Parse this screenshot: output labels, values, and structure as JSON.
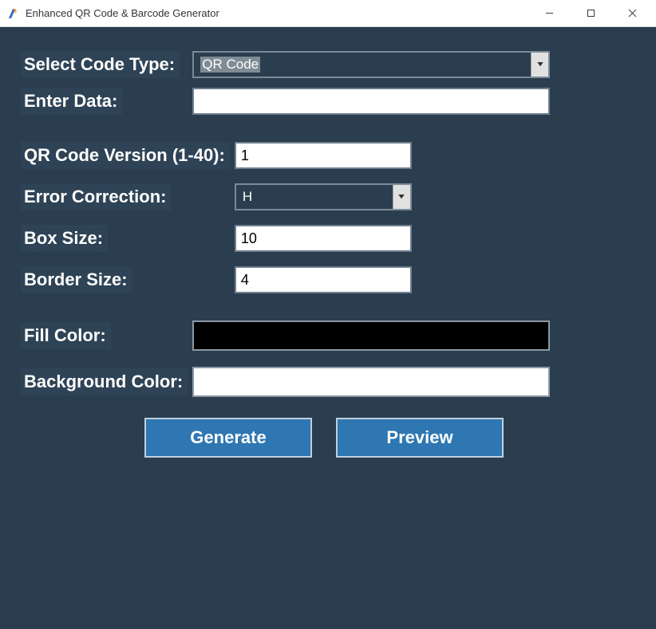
{
  "window": {
    "title": "Enhanced QR Code & Barcode Generator"
  },
  "labels": {
    "code_type": "Select Code Type:",
    "enter_data": "Enter Data:",
    "qr_version": "QR Code Version (1-40):",
    "error_corr": "Error Correction:",
    "box_size": "Box Size:",
    "border_size": "Border Size:",
    "fill_color": "Fill Color:",
    "bg_color": "Background Color:"
  },
  "values": {
    "code_type": "QR Code",
    "enter_data": "",
    "qr_version": "1",
    "error_corr": "H",
    "box_size": "10",
    "border_size": "4",
    "fill_color": "#000000",
    "bg_color": "#ffffff"
  },
  "buttons": {
    "generate": "Generate",
    "preview": "Preview"
  }
}
